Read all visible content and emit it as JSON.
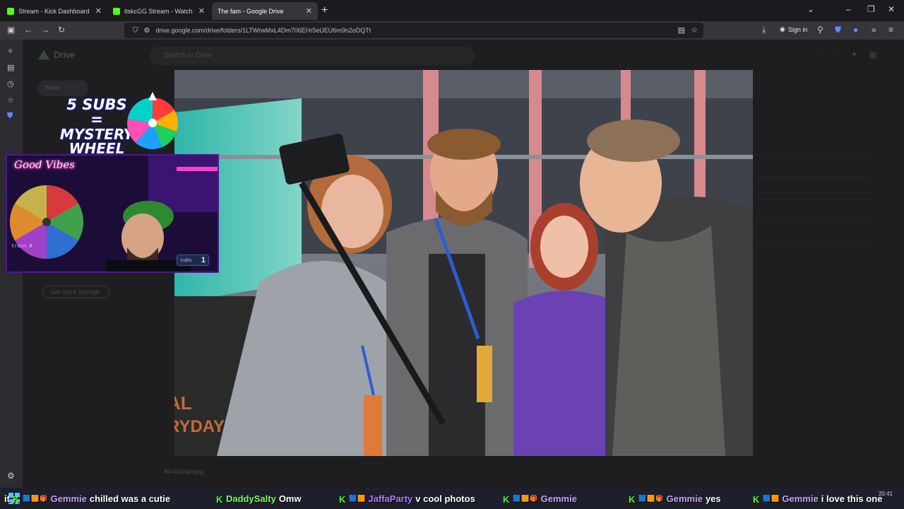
{
  "browser": {
    "tabs": [
      {
        "title": "Stream - Kick Dashboard",
        "active": false
      },
      {
        "title": "itskcGG Stream - Watch Live on Kick",
        "active": false
      },
      {
        "title": "The fam - Google Drive",
        "active": true
      }
    ],
    "new_tab_glyph": "+",
    "url": "drive.google.com/drive/folders/1LTWrwMxL4Dm706EHr5eUEU6m9n2oDQTt",
    "sign_in_label": "Sign in"
  },
  "drive": {
    "app_name": "Drive",
    "search_placeholder": "Search in Drive",
    "new_label": "New",
    "storage_label": "Get more storage",
    "file_name": "AF4n1dan.jpg"
  },
  "stream_overlay": {
    "promo_line1": "5 SUBS =",
    "promo_line2": "MYSTERY",
    "promo_line3": "WHEEL",
    "good_vibes": "Good Vibes",
    "trains_label": "train",
    "trains_value": "0",
    "subs_label": "subs",
    "subs_count": "1"
  },
  "chat_ticker": [
    {
      "username": "Gemmie",
      "message": "chilled was a cutie",
      "prefix": "it"
    },
    {
      "username": "DaddySalty",
      "message": "Omw"
    },
    {
      "username": "JaffaParty",
      "message": "v cool photos"
    },
    {
      "username": "Gemmie",
      "message": ""
    },
    {
      "username": "Gemmie",
      "message": "yes"
    },
    {
      "username": "Gemmie",
      "message": "i love this one"
    }
  ],
  "taskbar": {
    "time": "20:41"
  },
  "colors": {
    "kick_green": "#53fc18",
    "drive_blue": "#4285f4",
    "username_purple": "#c7a2ff",
    "username_green": "#7dff5a"
  }
}
